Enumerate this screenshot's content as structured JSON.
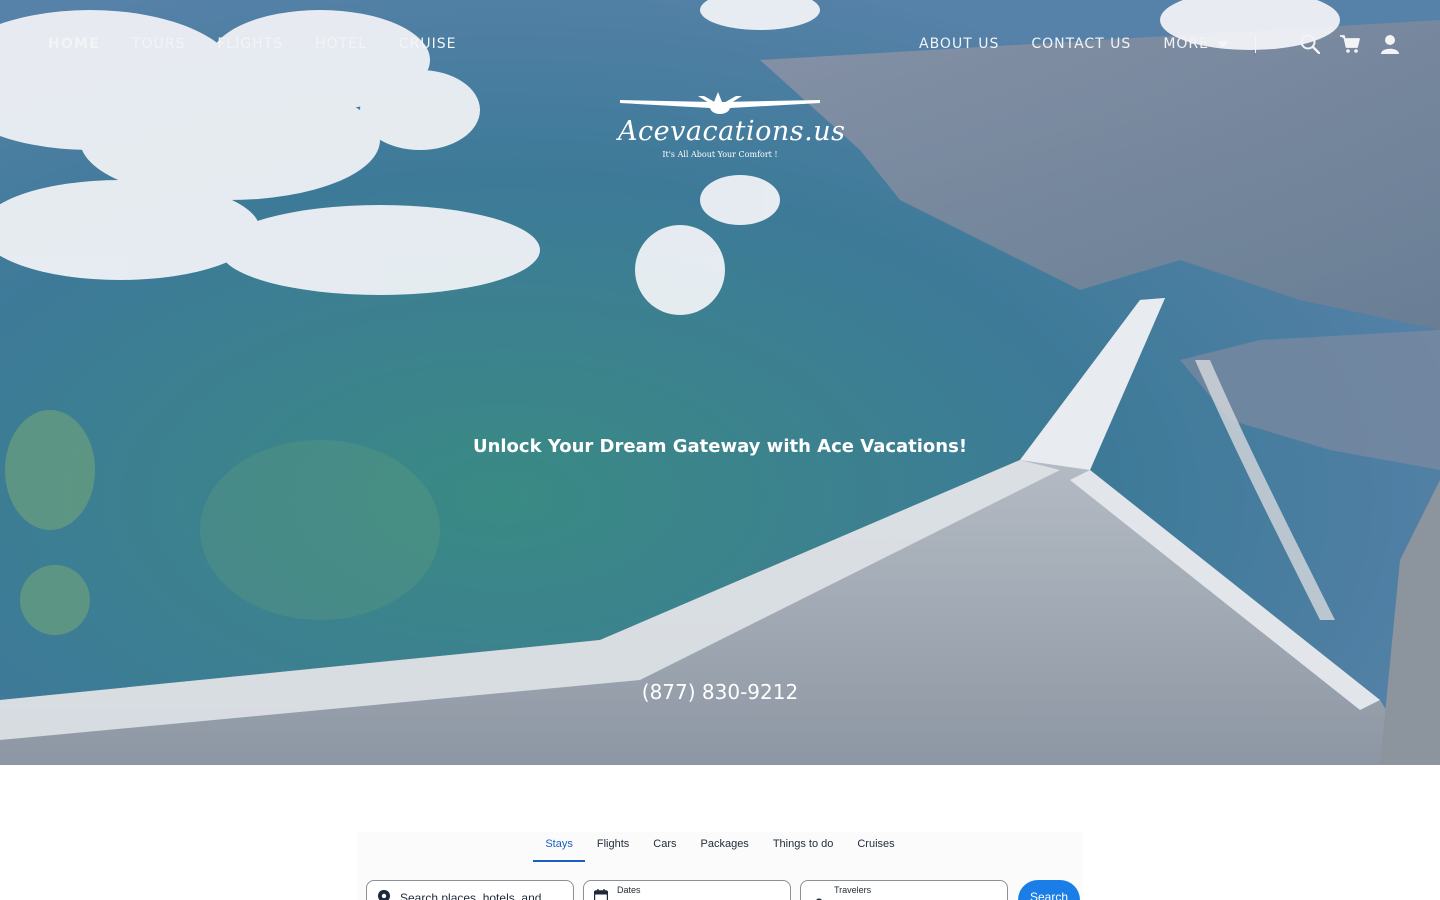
{
  "nav": {
    "left": [
      {
        "label": "HOME"
      },
      {
        "label": "TOURS"
      },
      {
        "label": "FLIGHTS"
      },
      {
        "label": "HOTEL"
      },
      {
        "label": "CRUISE"
      }
    ],
    "right": [
      {
        "label": "ABOUT US"
      },
      {
        "label": "CONTACT US"
      }
    ],
    "more_label": "MORE",
    "icons": [
      "search-icon",
      "cart-icon",
      "user-icon"
    ]
  },
  "logo": {
    "name": "Acevacations.us",
    "tagline": "It's All About Your Comfort !"
  },
  "hero": {
    "headline": "Unlock Your Dream Gateway with Ace Vacations!",
    "phone": "(877) 830-9212"
  },
  "search_widget": {
    "tabs": [
      "Stays",
      "Flights",
      "Cars",
      "Packages",
      "Things to do",
      "Cruises"
    ],
    "active_tab": "Stays",
    "destination_placeholder": "Search places, hotels, and...",
    "dates_label": "Dates",
    "travelers_label": "Travelers",
    "search_label": "Search"
  },
  "colors": {
    "accent": "#1a7ee6",
    "active_tab": "#1a5fc0"
  }
}
